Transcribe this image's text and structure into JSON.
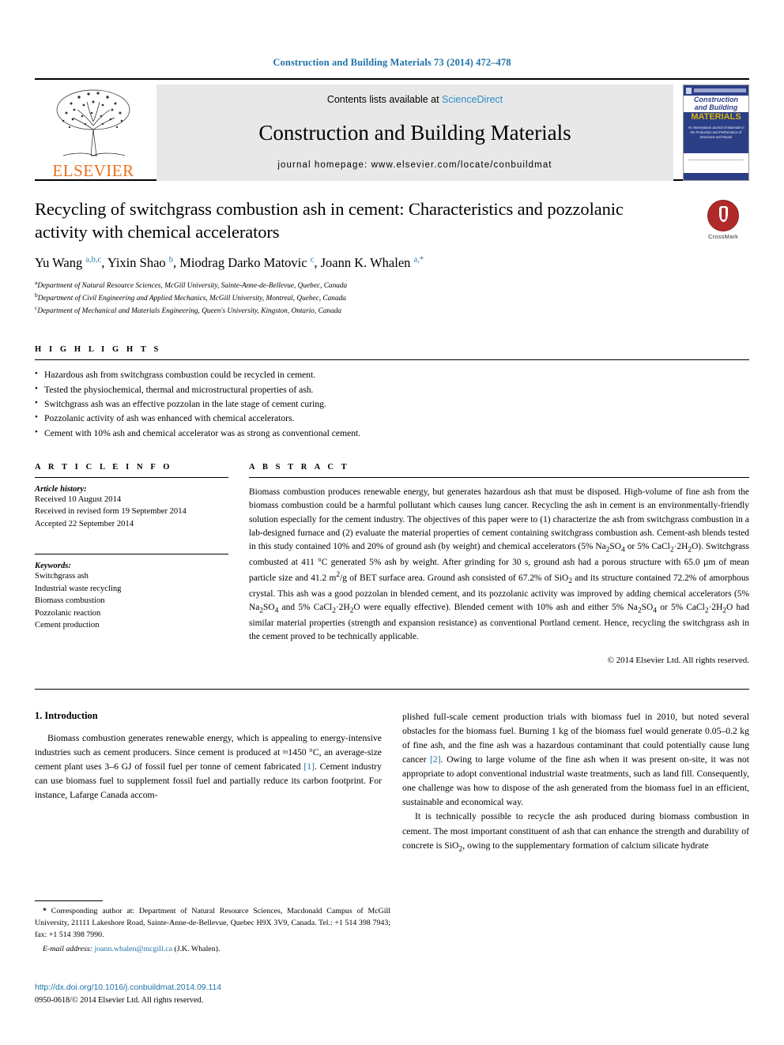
{
  "running_head": "Construction and Building Materials 73 (2014) 472–478",
  "masthead": {
    "contents_prefix": "Contents lists available at ",
    "sciencedirect": "ScienceDirect",
    "journal_title": "Construction and Building Materials",
    "homepage": "journal homepage: www.elsevier.com/locate/conbuildmat",
    "publisher_logo_text": "ELSEVIER",
    "cover": {
      "line1": "Construction",
      "line2": "and Building",
      "line3": "MATERIALS",
      "caption": "An International Journal of Materials in the Production and Performance of Structures and Repair"
    },
    "accent_blue": "#2b8cc4",
    "elsevier_orange": "#e9711c"
  },
  "article": {
    "title": "Recycling of switchgrass combustion ash in cement: Characteristics and pozzolanic activity with chemical accelerators",
    "crossmark_label": "CrossMark",
    "authors_html": "Yu Wang <sup>a,b,c</sup>, Yixin Shao <sup>b</sup>, Miodrag Darko Matovic <sup>c</sup>, Joann K. Whalen <sup>a,</sup><sup>*</sup>",
    "affiliations": [
      "Department of Natural Resource Sciences, McGill University, Sainte-Anne-de-Bellevue, Quebec, Canada",
      "Department of Civil Engineering and Applied Mechanics, McGill University, Montreal, Quebec, Canada",
      "Department of Mechanical and Materials Engineering, Queen's University, Kingston, Ontario, Canada"
    ],
    "affiliation_marks": [
      "a",
      "b",
      "c"
    ]
  },
  "highlights": {
    "label": "H I G H L I G H T S",
    "items": [
      "Hazardous ash from switchgrass combustion could be recycled in cement.",
      "Tested the physiochemical, thermal and microstructural properties of ash.",
      "Switchgrass ash was an effective pozzolan in the late stage of cement curing.",
      "Pozzolanic activity of ash was enhanced with chemical accelerators.",
      "Cement with 10% ash and chemical accelerator was as strong as conventional cement."
    ]
  },
  "article_info": {
    "label": "A R T I C L E    I N F O",
    "history_title": "Article history:",
    "history": [
      "Received 10 August 2014",
      "Received in revised form 19 September 2014",
      "Accepted 22 September 2014"
    ],
    "keywords_title": "Keywords:",
    "keywords": [
      "Switchgrass ash",
      "Industrial waste recycling",
      "Biomass combustion",
      "Pozzolanic reaction",
      "Cement production"
    ]
  },
  "abstract": {
    "label": "A B S T R A C T",
    "text_html": "Biomass combustion produces renewable energy, but generates hazardous ash that must be disposed. High-volume of fine ash from the biomass combustion could be a harmful pollutant which causes lung cancer. Recycling the ash in cement is an environmentally-friendly solution especially for the cement industry. The objectives of this paper were to (1) characterize the ash from switchgrass combustion in a lab-designed furnace and (2) evaluate the material properties of cement containing switchgrass combustion ash. Cement-ash blends tested in this study contained 10% and 20% of ground ash (by weight) and chemical accelerators (5% Na<sub>2</sub>SO<sub>4</sub> or 5% CaCl<sub>2</sub>·2H<sub>2</sub>O). Switchgrass combusted at 411 °C generated 5% ash by weight. After grinding for 30 s, ground ash had a porous structure with 65.0 µm of mean particle size and 41.2 m<sup>2</sup>/g of BET surface area. Ground ash consisted of 67.2% of SiO<sub>2</sub> and its structure contained 72.2% of amorphous crystal. This ash was a good pozzolan in blended cement, and its pozzolanic activity was improved by adding chemical accelerators (5% Na<sub>2</sub>SO<sub>4</sub> and 5% CaCl<sub>2</sub>·2H<sub>2</sub>O were equally effective). Blended cement with 10% ash and either 5% Na<sub>2</sub>SO<sub>4</sub> or 5% CaCl<sub>2</sub>·2H<sub>2</sub>O had similar material properties (strength and expansion resistance) as conventional Portland cement. Hence, recycling the switchgrass ash in the cement proved to be technically applicable.",
    "copyright": "© 2014 Elsevier Ltd. All rights reserved."
  },
  "introduction": {
    "heading": "1. Introduction",
    "left_paragraph_html": "Biomass combustion generates renewable energy, which is appealing to energy-intensive industries such as cement producers. Since cement is produced at &asymp;1450 °C, an average-size cement plant uses 3–6 GJ of fossil fuel per tonne of cement fabricated <span class=\"ref\">[1]</span>. Cement industry can use biomass fuel to supplement fossil fuel and partially reduce its carbon footprint. For instance, Lafarge Canada accom-",
    "right_paragraph1_html": "plished full-scale cement production trials with biomass fuel in 2010, but noted several obstacles for the biomass fuel. Burning 1 kg of the biomass fuel would generate 0.05–0.2 kg of fine ash, and the fine ash was a hazardous contaminant that could potentially cause lung cancer <span class=\"ref\">[2]</span>. Owing to large volume of the fine ash when it was present on-site, it was not appropriate to adopt conventional industrial waste treatments, such as land fill. Consequently, one challenge was how to dispose of the ash generated from the biomass fuel in an efficient, sustainable and economical way.",
    "right_paragraph2_html": "It is technically possible to recycle the ash produced during biomass combustion in cement. The most important constituent of ash that can enhance the strength and durability of concrete is SiO<sub>2</sub>, owing to the supplementary formation of calcium silicate hydrate"
  },
  "footer": {
    "corresponding_html": "<b>*</b> Corresponding author at: Department of Natural Resource Sciences, Macdonald Campus of McGill University, 21111 Lakeshore Road, Sainte-Anne-de-Bellevue, Quebec H9X 3V9, Canada. Tel.: +1 514 398 7943; fax: +1 514 398 7990.",
    "email_label": "E-mail address:",
    "email": "joann.whalen@mcgill.ca",
    "email_owner": "(J.K. Whalen).",
    "doi": "http://dx.doi.org/10.1016/j.conbuildmat.2014.09.114",
    "issn": "0950-0618/© 2014 Elsevier Ltd. All rights reserved."
  }
}
